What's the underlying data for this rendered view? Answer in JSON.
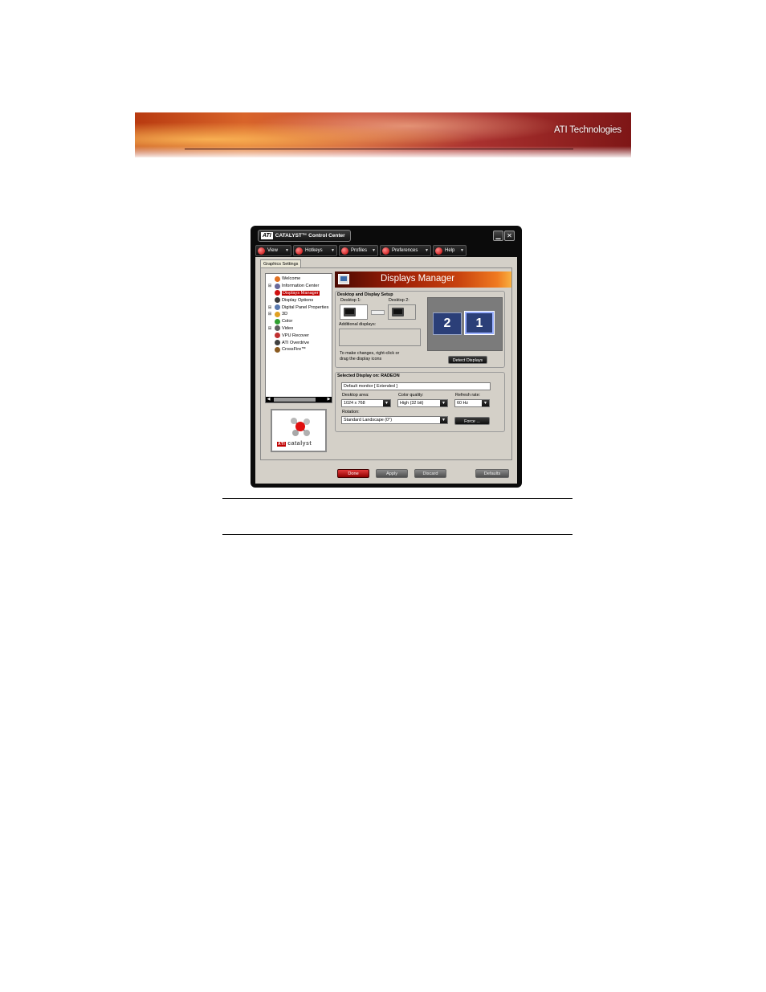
{
  "page": {
    "brand": "ATI Technologies"
  },
  "window": {
    "title_logo": "ATI",
    "title": "CATALYST™ Control Center",
    "minimize_glyph": "▁",
    "close_glyph": "✕",
    "menu": [
      {
        "label": "View",
        "icon": "view-icon"
      },
      {
        "label": "Hotkeys",
        "icon": "hotkeys-icon"
      },
      {
        "label": "Profiles",
        "icon": "profiles-icon"
      },
      {
        "label": "Preferences",
        "icon": "preferences-icon"
      },
      {
        "label": "Help",
        "icon": "help-icon"
      }
    ],
    "tab": "Graphics Settings"
  },
  "tree": {
    "items": [
      {
        "label": "Welcome",
        "expander": "",
        "color": "#e07020"
      },
      {
        "label": "Information Center",
        "expander": "⊞",
        "color": "#6a6a9a"
      },
      {
        "label": "Displays Manager",
        "expander": "",
        "color": "#d01010",
        "selected": true
      },
      {
        "label": "Display Options",
        "expander": "",
        "color": "#3a3a3a"
      },
      {
        "label": "Digital Panel Properties",
        "expander": "⊞",
        "color": "#5a7ab0"
      },
      {
        "label": "3D",
        "expander": "⊞",
        "color": "#e0a020"
      },
      {
        "label": "Color",
        "expander": "",
        "color": "#30a030"
      },
      {
        "label": "Video",
        "expander": "⊞",
        "color": "#606060"
      },
      {
        "label": "VPU Recover",
        "expander": "",
        "color": "#c03030"
      },
      {
        "label": "ATI Overdrive",
        "expander": "",
        "color": "#404040"
      },
      {
        "label": "CrossFire™",
        "expander": "",
        "color": "#8a5a20"
      }
    ],
    "scroll_left": "◀",
    "scroll_right": "▶"
  },
  "logo": {
    "ati": "ATI",
    "caption": "catalyst"
  },
  "displays_manager": {
    "title": "Displays Manager",
    "setup": {
      "title": "Desktop and Display Setup",
      "desktop1": "Desktop 1:",
      "desktop2": "Desktop 2:",
      "additional": "Additional displays:",
      "hint_line1": "To make changes, right-click or",
      "hint_line2": "drag the display icons",
      "tile_left": "2",
      "tile_right": "1",
      "detect_button": "Detect Displays"
    },
    "selected": {
      "title": "Selected Display on: RADEON",
      "monitor": "Default monitor [ Extended ]",
      "desktop_area_label": "Desktop area:",
      "desktop_area_value": "1024 x 768",
      "color_quality_label": "Color quality:",
      "color_quality_value": "High (32 bit)",
      "refresh_rate_label": "Refresh rate:",
      "refresh_rate_value": "60 Hz",
      "rotation_label": "Rotation:",
      "rotation_value": "Standard Landscape (0°)",
      "force_button": "Force ..."
    }
  },
  "buttons": {
    "done": "Done",
    "apply": "Apply",
    "discard": "Discard",
    "defaults": "Defaults"
  },
  "colors": {
    "accent": "#c00000",
    "window_bg": "#0b0b0b",
    "panel_bg": "#d4d0c8"
  }
}
